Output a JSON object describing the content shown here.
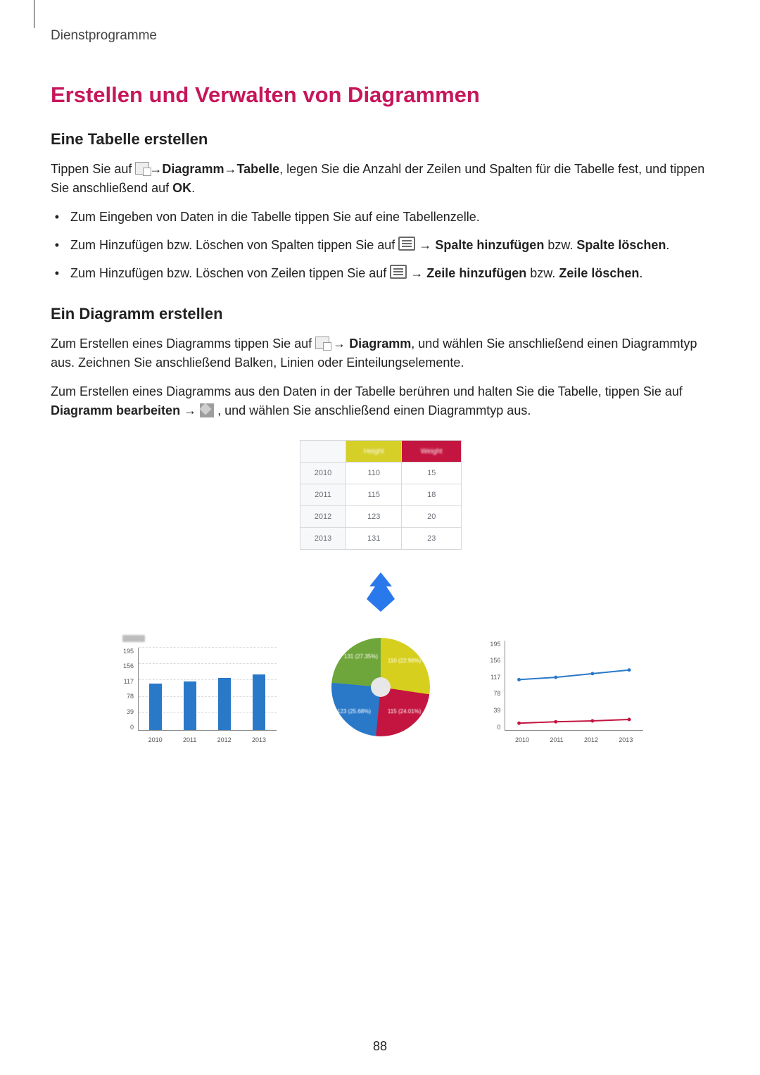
{
  "breadcrumb": "Dienstprogramme",
  "h1": "Erstellen und Verwalten von Diagrammen",
  "sec1": {
    "h2": "Eine Tabelle erstellen",
    "p_before_icon": "Tippen Sie auf ",
    "arrow1": " → ",
    "kw1": "Diagramm",
    "arrow2": " → ",
    "kw2": "Tabelle",
    "p_after": ", legen Sie die Anzahl der Zeilen und Spalten für die Tabelle fest, und tippen Sie anschließend auf ",
    "kw3": "OK",
    "period": ".",
    "li1": "Zum Eingeben von Daten in die Tabelle tippen Sie auf eine Tabellenzelle.",
    "li2a": "Zum Hinzufügen bzw. Löschen von Spalten tippen Sie auf ",
    "li2_arrow": " → ",
    "li2b": "Spalte hinzufügen",
    "li2c": " bzw. ",
    "li2d": "Spalte löschen",
    "li3a": "Zum Hinzufügen bzw. Löschen von Zeilen tippen Sie auf ",
    "li3_arrow": " → ",
    "li3b": "Zeile hinzufügen",
    "li3c": " bzw. ",
    "li3d": "Zeile löschen"
  },
  "sec2": {
    "h2": "Ein Diagramm erstellen",
    "p1a": "Zum Erstellen eines Diagramms tippen Sie auf ",
    "p1_arrow": " → ",
    "p1b": "Diagramm",
    "p1c": ", und wählen Sie anschließend einen Diagrammtyp aus. Zeichnen Sie anschließend Balken, Linien oder Einteilungselemente.",
    "p2a": "Zum Erstellen eines Diagramms aus den Daten in der Tabelle berühren und halten Sie die Tabelle, tippen Sie auf ",
    "p2b": "Diagramm bearbeiten",
    "p2_arrow": " → ",
    "p2c": " , und wählen Sie anschließend einen Diagrammtyp aus."
  },
  "chart_data": [
    {
      "type": "table",
      "headers": [
        "",
        "Height",
        "Weight"
      ],
      "rows": [
        [
          "2010",
          110,
          15
        ],
        [
          "2011",
          115,
          18
        ],
        [
          "2012",
          123,
          20
        ],
        [
          "2013",
          131,
          23
        ]
      ]
    },
    {
      "type": "bar",
      "title": "",
      "xlabel": "",
      "ylabel": "",
      "categories": [
        "2010",
        "2011",
        "2012",
        "2013"
      ],
      "values": [
        110,
        115,
        123,
        131
      ],
      "y_ticks": [
        0,
        39,
        78,
        117,
        156,
        195
      ],
      "ylim": [
        0,
        195
      ]
    },
    {
      "type": "pie",
      "slices": [
        {
          "label": "131 (27.35%)",
          "value": 131,
          "color": "#d7cf1e"
        },
        {
          "label": "110 (22.96%)",
          "value": 110,
          "color": "#c3153f"
        },
        {
          "label": "115 (24.01%)",
          "value": 115,
          "color": "#2a79c9"
        },
        {
          "label": "123 (25.68%)",
          "value": 123,
          "color": "#6fa63b"
        }
      ]
    },
    {
      "type": "line",
      "categories": [
        "2010",
        "2011",
        "2012",
        "2013"
      ],
      "series": [
        {
          "name": "Height",
          "values": [
            110,
            115,
            123,
            131
          ],
          "color": "#2a79c9"
        },
        {
          "name": "Weight",
          "values": [
            15,
            18,
            20,
            23
          ],
          "color": "#c3153f"
        }
      ],
      "y_ticks": [
        0,
        39,
        78,
        117,
        156,
        195
      ],
      "ylim": [
        0,
        195
      ]
    }
  ],
  "page_number": "88"
}
